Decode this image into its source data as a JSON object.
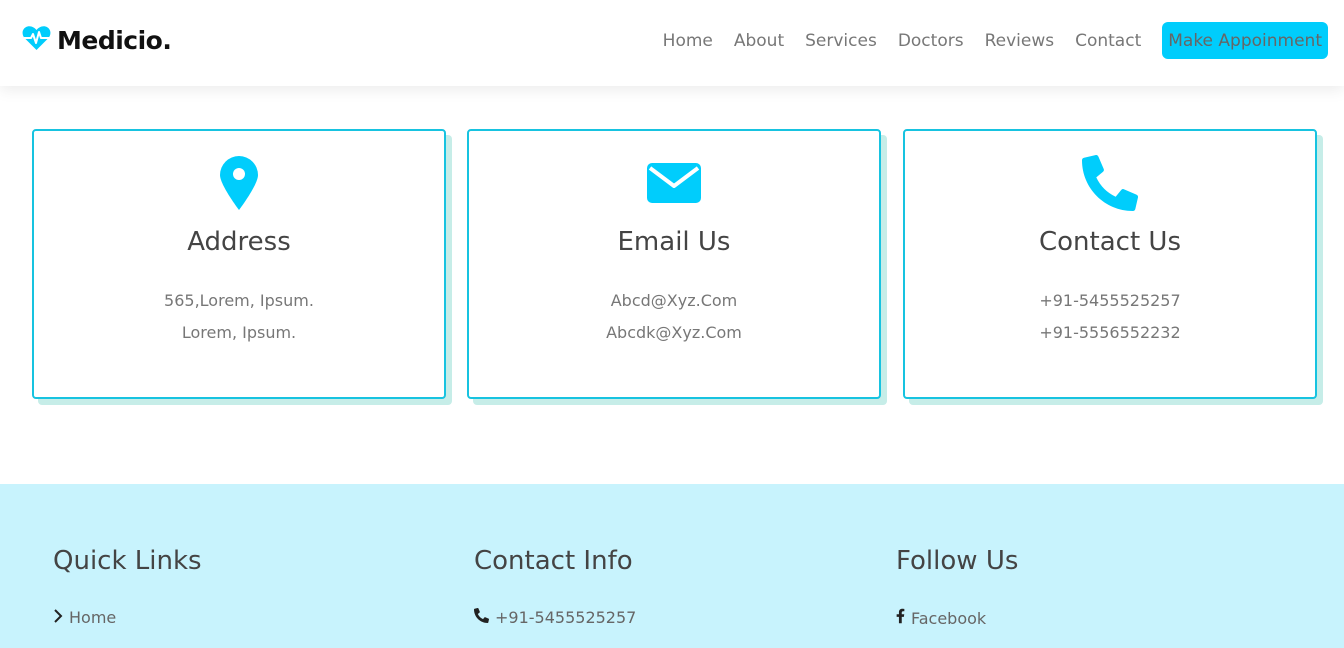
{
  "brand": {
    "name": "Medicio.",
    "icon": "heart-pulse-icon",
    "accent": "#00cdfc"
  },
  "nav": {
    "links": [
      "Home",
      "About",
      "Services",
      "Doctors",
      "Reviews",
      "Contact"
    ],
    "cta": "Make Appoinment"
  },
  "cards": [
    {
      "icon": "map-marker-icon",
      "title": "Address",
      "lines": [
        "565,Lorem, Ipsum.",
        "Lorem, Ipsum."
      ]
    },
    {
      "icon": "envelope-icon",
      "title": "Email Us",
      "lines": [
        "Abcd@Xyz.Com",
        "Abcdk@Xyz.Com"
      ]
    },
    {
      "icon": "phone-icon",
      "title": "Contact Us",
      "lines": [
        "+91-5455525257",
        "+91-5556552232"
      ]
    }
  ],
  "footer": {
    "quick_links": {
      "title": "Quick Links",
      "items": [
        {
          "icon": "chevron-right-icon",
          "label": "Home"
        }
      ]
    },
    "contact_info": {
      "title": "Contact Info",
      "items": [
        {
          "icon": "phone-icon",
          "label": "+91-5455525257"
        }
      ]
    },
    "follow_us": {
      "title": "Follow Us",
      "items": [
        {
          "icon": "facebook-icon",
          "label": "Facebook"
        }
      ]
    }
  },
  "colors": {
    "card_border": "#17c3e0",
    "card_shadow": "#c6ede8",
    "footer_bg": "#c8f3fd"
  }
}
